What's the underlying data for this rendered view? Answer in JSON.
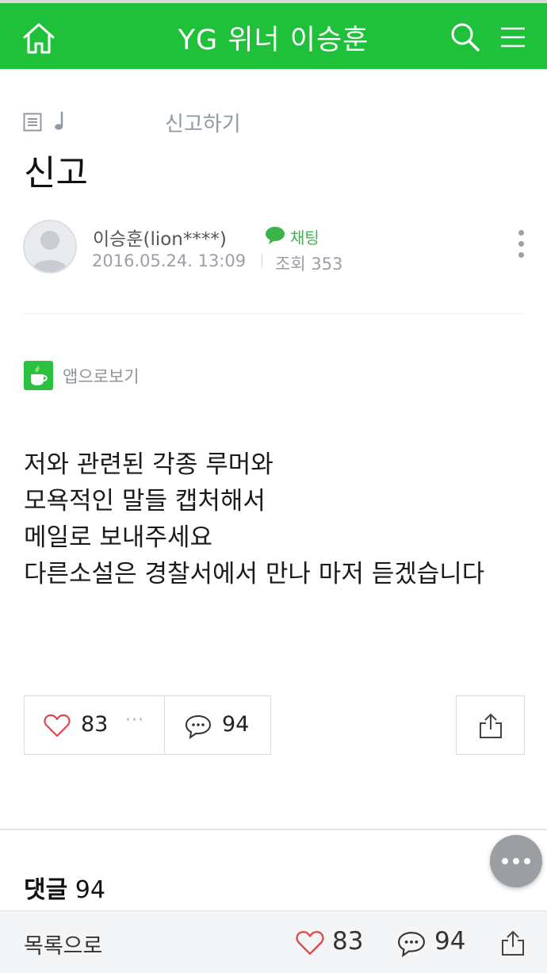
{
  "topbar": {
    "title": "YG 위너 이승훈"
  },
  "breadcrumb": {
    "label": "신고하기"
  },
  "post": {
    "title": "신고",
    "author": "이승훈(lion****)",
    "chat_label": "채팅",
    "date": "2016.05.24. 13:09",
    "views_label": "조회",
    "views": "353",
    "app_view_label": "앱으로보기",
    "body_lines": [
      "저와 관련된 각종 루머와",
      "모욕적인 말들 캡처해서",
      "메일로 보내주세요",
      "다른소설은 경찰서에서 만나 마저 듣겠습니다"
    ]
  },
  "actions": {
    "likes": "83",
    "more": "···",
    "comments": "94"
  },
  "comments_section": {
    "label": "댓글",
    "count": "94"
  },
  "bottombar": {
    "back_label": "목록으로",
    "likes": "83",
    "comments": "94"
  },
  "colors": {
    "brand": "#1fc13a",
    "like": "#e0444d"
  },
  "icons": [
    "home-icon",
    "search-icon",
    "menu-icon",
    "list-icon",
    "music-note-icon",
    "chat-icon",
    "more-vert-icon",
    "app-icon",
    "heart-icon",
    "comment-icon",
    "share-icon",
    "more-horiz-icon"
  ]
}
